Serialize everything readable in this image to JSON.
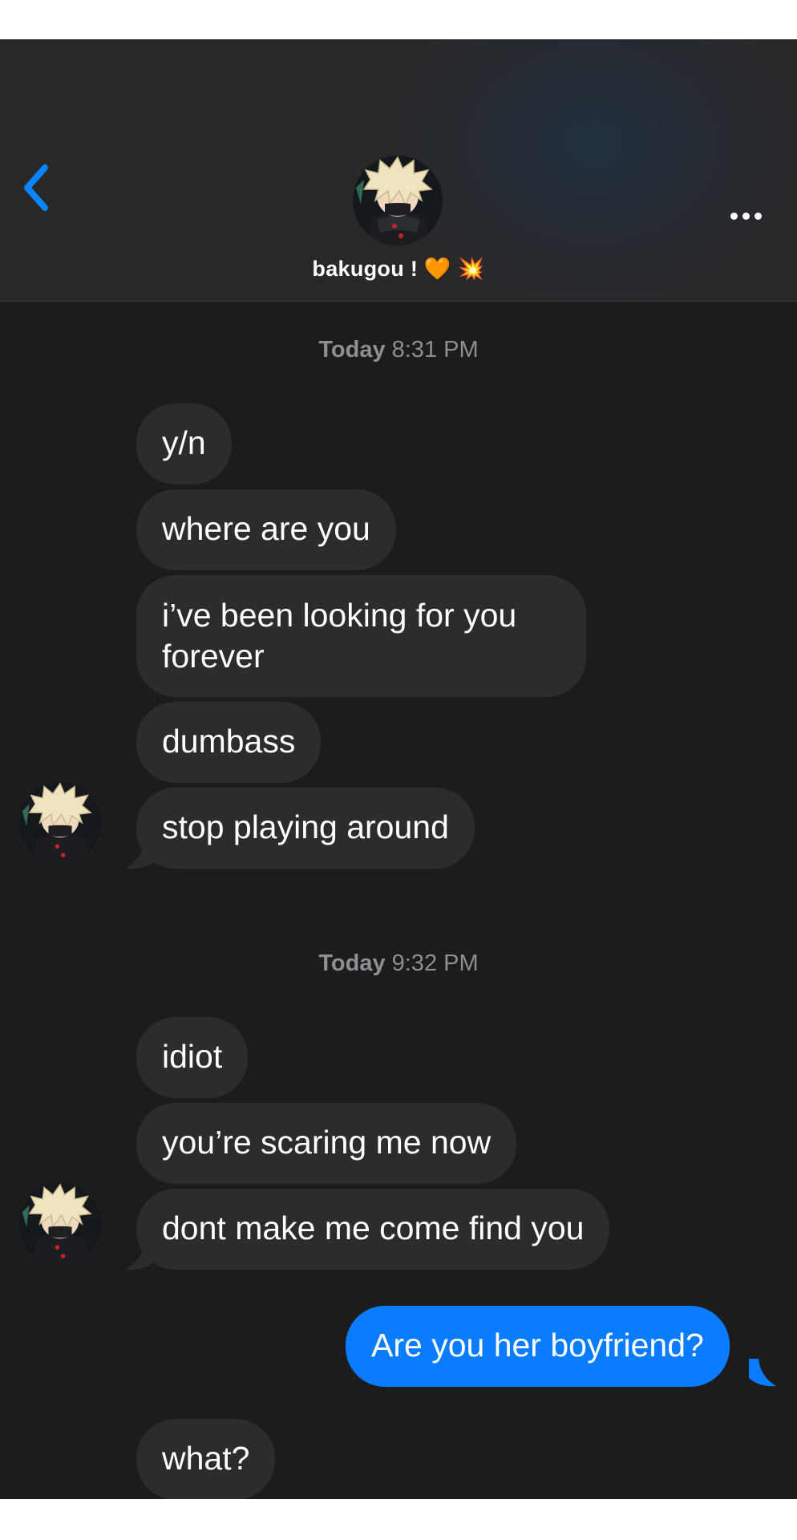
{
  "header": {
    "back_icon": "chevron-left-icon",
    "contact_name": "bakugou ! 🧡 💥",
    "more_icon": "ellipsis-icon",
    "accent_color": "#0a84ff"
  },
  "timestamps": [
    {
      "day": "Today",
      "time": "8:31 PM"
    },
    {
      "day": "Today",
      "time": "9:32 PM"
    }
  ],
  "messages": [
    {
      "sender": "contact",
      "text": "y/n"
    },
    {
      "sender": "contact",
      "text": "where are you"
    },
    {
      "sender": "contact",
      "text": "i’ve been looking for you forever"
    },
    {
      "sender": "contact",
      "text": "dumbass"
    },
    {
      "sender": "contact",
      "text": "stop playing around"
    },
    {
      "sender": "contact",
      "text": "idiot"
    },
    {
      "sender": "contact",
      "text": "you’re scaring me now"
    },
    {
      "sender": "contact",
      "text": "dont make me come find you"
    },
    {
      "sender": "me",
      "text": "Are you her boyfriend?"
    },
    {
      "sender": "contact",
      "text": "what?"
    }
  ],
  "colors": {
    "received_bubble": "#2c2c2e",
    "sent_bubble": "#0a7cff",
    "background": "#1c1c1e",
    "timestamp_text": "#8e8e93"
  }
}
